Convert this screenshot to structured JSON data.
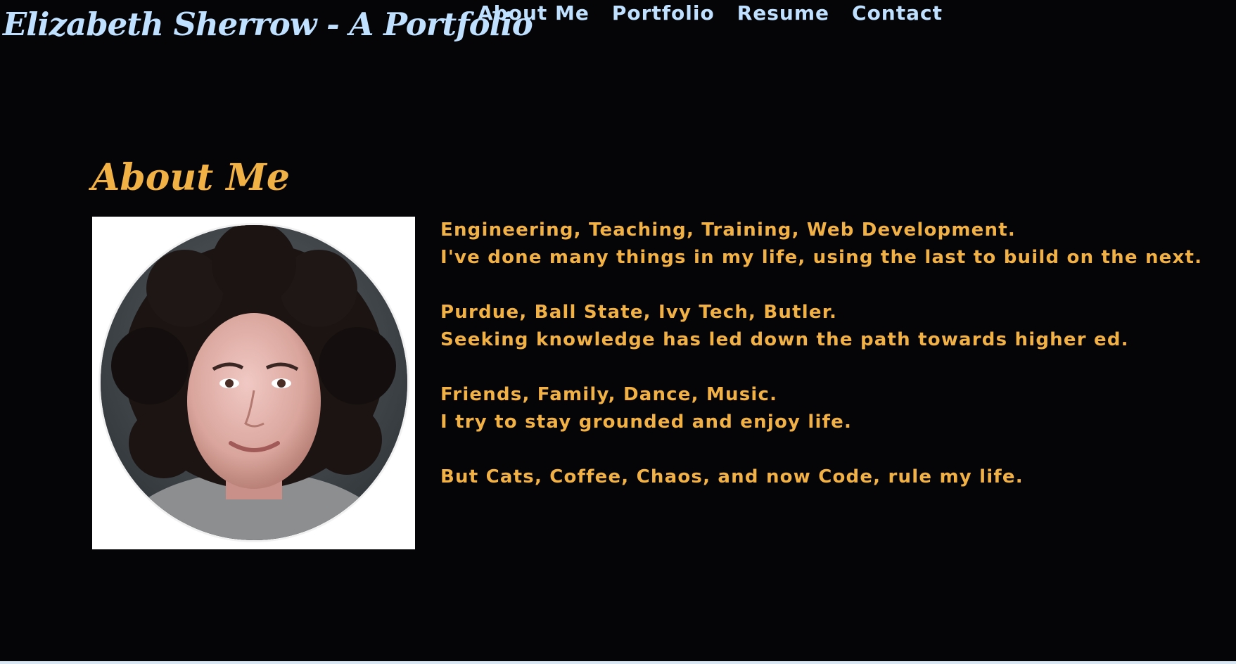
{
  "header": {
    "brand": "Elizabeth Sherrow - A Portfolio",
    "nav": [
      {
        "label": "About Me"
      },
      {
        "label": "Portfolio"
      },
      {
        "label": "Resume"
      },
      {
        "label": "Contact"
      }
    ]
  },
  "about": {
    "title": "About Me",
    "photo_alt": "Profile photo",
    "blocks": [
      {
        "line1": "Engineering, Teaching, Training, Web Development.",
        "line2": "I've done many things in my life, using the last to build on the next."
      },
      {
        "line1": "Purdue, Ball State, Ivy Tech, Butler.",
        "line2": "Seeking knowledge has led down the path towards higher ed."
      },
      {
        "line1": "Friends, Family, Dance, Music.",
        "line2": "I try to stay grounded and enjoy life."
      },
      {
        "line1": "But Cats, Coffee, Chaos, and now Code, rule my life.",
        "line2": ""
      }
    ]
  },
  "colors": {
    "background": "#050508",
    "nav_text": "#bfe0ff",
    "accent": "#f2b145"
  }
}
